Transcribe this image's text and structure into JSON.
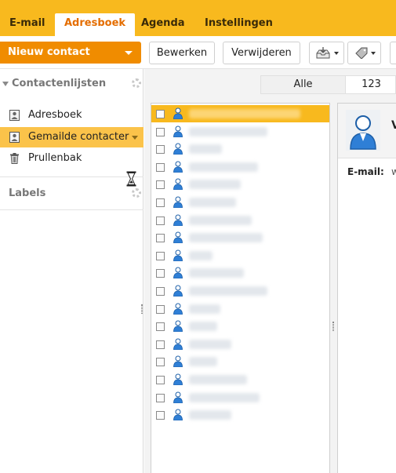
{
  "tabs": [
    {
      "label": "E-mail"
    },
    {
      "label": "Adresboek",
      "active": true
    },
    {
      "label": "Agenda"
    },
    {
      "label": "Instellingen"
    }
  ],
  "toolbar": {
    "new_contact": "Nieuw contact",
    "edit": "Bewerken",
    "delete": "Verwijderen",
    "import_icon": "inbox-tray-icon",
    "tag_icon": "tag-icon"
  },
  "sidebar": {
    "contact_lists_heading": "Contactenlijsten",
    "items": [
      {
        "label": "Adresboek",
        "icon": "address-book-icon"
      },
      {
        "label": "Gemailde contacter",
        "icon": "address-book-icon",
        "active": true
      },
      {
        "label": "Prullenbak",
        "icon": "trash-icon"
      }
    ],
    "labels_heading": "Labels"
  },
  "filter": {
    "all": "Alle",
    "numeric": "123"
  },
  "contacts_count_visible": 18,
  "detail": {
    "name": "V",
    "email_label": "E-mail:",
    "email_value": "w"
  },
  "colors": {
    "brand": "#f8b91e",
    "accent": "#f08c00",
    "active_item": "#fbc34a"
  }
}
